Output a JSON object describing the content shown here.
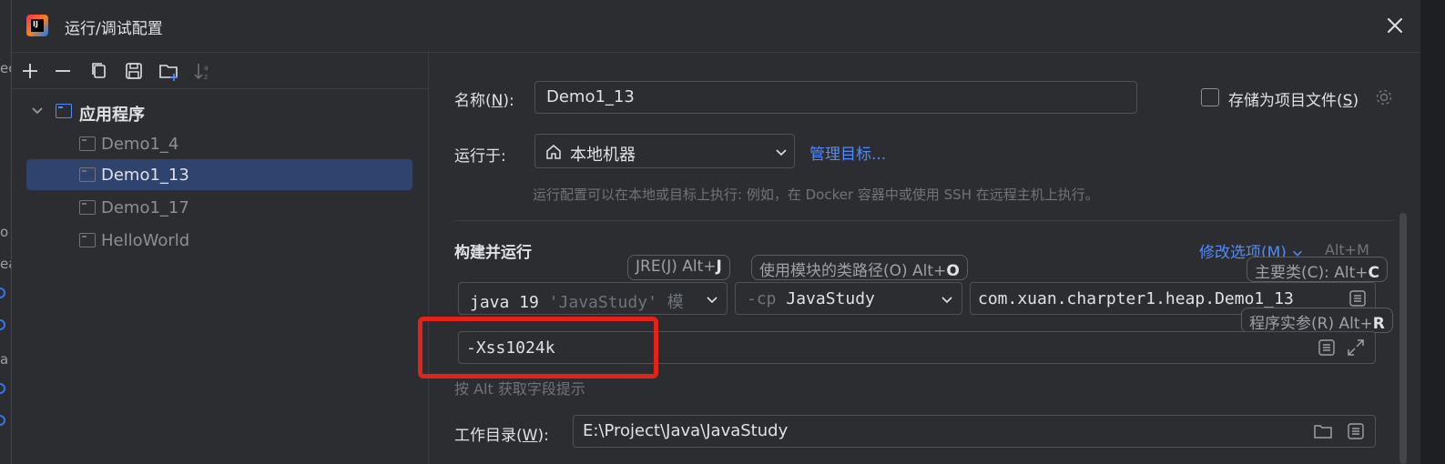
{
  "background": {
    "left_fragments": [
      "ec",
      "o",
      "ea",
      "a"
    ]
  },
  "dialog": {
    "title": "运行/调试配置",
    "logo_text": "IJ"
  },
  "toolbar": {
    "buttons": [
      "plus-icon",
      "minus-icon",
      "copy-icon",
      "save-icon",
      "new-folder-icon",
      "sort-icon"
    ]
  },
  "tree": {
    "group_label": "应用程序",
    "items": [
      {
        "label": "Demo1_4",
        "selected": false
      },
      {
        "label": "Demo1_13",
        "selected": true
      },
      {
        "label": "Demo1_17",
        "selected": false
      },
      {
        "label": "HelloWorld",
        "selected": false
      }
    ]
  },
  "form": {
    "name_label": "名称(",
    "name_mnemonic": "N",
    "name_label_end": "):",
    "name_value": "Demo1_13",
    "store_label": "存储为项目文件(",
    "store_mnemonic": "S",
    "store_label_end": ")",
    "run_on_label": "运行于:",
    "run_on_value": "本地机器",
    "manage_targets": "管理目标...",
    "run_on_hint": "运行配置可以在本地或目标上执行: 例如，在 Docker 容器中或使用 SSH 在远程主机上执行。",
    "section_title": "构建并运行",
    "modify_options": "修改选项(M)",
    "modify_shortcut": "Alt+M",
    "jre_chip": "JRE(J) Alt+",
    "jre_chip_key": "J",
    "module_chip": "使用模块的类路径(O) Alt+",
    "module_chip_key": "O",
    "main_class_chip": "主要类(C): Alt+",
    "main_class_chip_key": "C",
    "jre_value": "java 19",
    "jre_suffix": "'JavaStudy' 模",
    "cp_prefix": "-cp",
    "cp_value": "JavaStudy",
    "main_class_value": "com.xuan.charpter1.heap.Demo1_13",
    "program_args_chip": "程序实参(R) Alt+",
    "program_args_chip_key": "R",
    "vm_options_value": "-Xss1024k",
    "alt_hint": "按 Alt 获取字段提示",
    "workdir_label": "工作目录(",
    "workdir_mnemonic": "W",
    "workdir_label_end": "):",
    "workdir_value": "E:\\Project\\Java\\JavaStudy"
  },
  "colors": {
    "accent": "#548af7",
    "selection": "#2e436e",
    "highlight_box": "#e2231a"
  }
}
